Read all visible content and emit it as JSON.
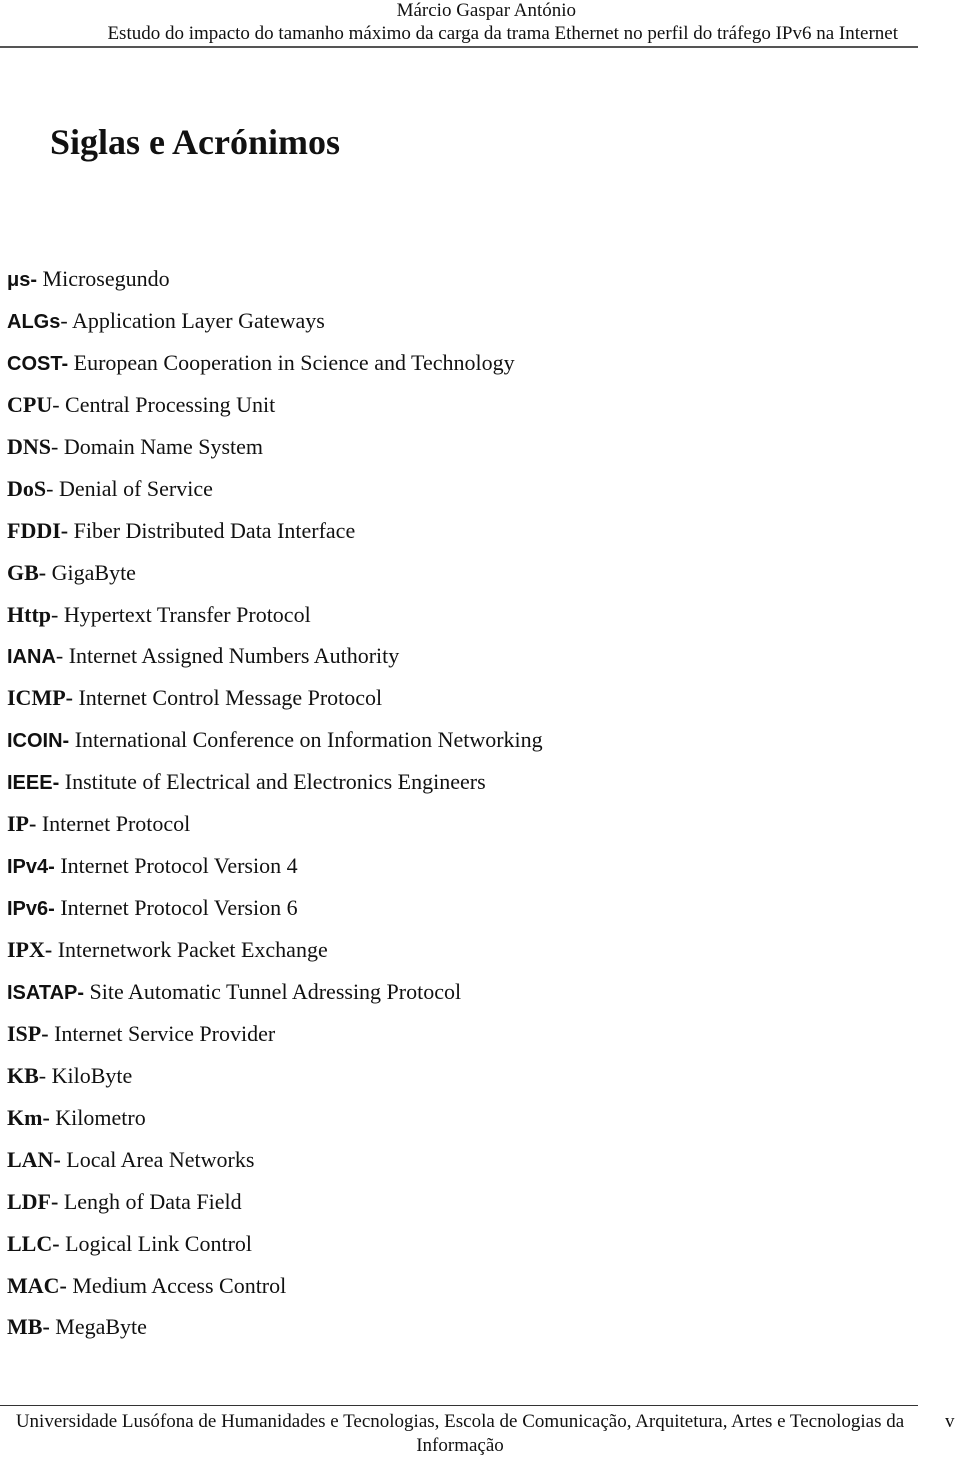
{
  "header": {
    "author": "Márcio Gaspar António",
    "thesis_title": "Estudo do impacto do tamanho máximo da carga da trama Ethernet no perfil do tráfego IPv6 na Internet"
  },
  "page_title": "Siglas e Acrónimos",
  "acronyms": [
    {
      "abbr": "μs-",
      "definition": " Microsegundo"
    },
    {
      "abbr": "ALGs",
      "definition": "- Application Layer Gateways"
    },
    {
      "abbr": "COST-",
      "definition": " European Cooperation in Science and Technology"
    },
    {
      "abbr": "CPU",
      "definition": "- Central Processing Unit"
    },
    {
      "abbr": "DNS",
      "definition": "- Domain Name System"
    },
    {
      "abbr": "DoS",
      "definition": "- Denial of Service"
    },
    {
      "abbr": "FDDI-",
      "definition": " Fiber Distributed Data Interface"
    },
    {
      "abbr": "GB-",
      "definition": " GigaByte"
    },
    {
      "abbr": "Http",
      "definition": "- Hypertext Transfer Protocol"
    },
    {
      "abbr": "IANA",
      "definition": "- Internet Assigned Numbers Authority"
    },
    {
      "abbr": "ICMP-",
      "definition": " Internet Control Message Protocol"
    },
    {
      "abbr": "ICOIN-",
      "definition": " International Conference on Information Networking"
    },
    {
      "abbr": "IEEE-",
      "definition": " Institute of Electrical and Electronics Engineers"
    },
    {
      "abbr": "IP-",
      "definition": " Internet Protocol"
    },
    {
      "abbr": "IPv4-",
      "definition": " Internet Protocol Version 4"
    },
    {
      "abbr": "IPv6-",
      "definition": " Internet Protocol Version 6"
    },
    {
      "abbr": "IPX-",
      "definition": " Internetwork Packet Exchange"
    },
    {
      "abbr": "ISATAP-",
      "definition": " Site Automatic Tunnel Adressing Protocol"
    },
    {
      "abbr": "ISP-",
      "definition": " Internet Service Provider"
    },
    {
      "abbr": "KB",
      "definition": "- KiloByte"
    },
    {
      "abbr": "Km-",
      "definition": " Kilometro"
    },
    {
      "abbr": "LAN-",
      "definition": " Local Area Networks"
    },
    {
      "abbr": "LDF-",
      "definition": " Lengh of Data Field"
    },
    {
      "abbr": "LLC-",
      "definition": " Logical Link Control"
    },
    {
      "abbr": "MAC-",
      "definition": " Medium Access Control"
    },
    {
      "abbr": "MB-",
      "definition": " MegaByte"
    }
  ],
  "footer": {
    "institution": "Universidade Lusófona de Humanidades e Tecnologias, Escola de Comunicação, Arquitetura, Artes e Tecnologias da Informação",
    "page_number": "v"
  }
}
